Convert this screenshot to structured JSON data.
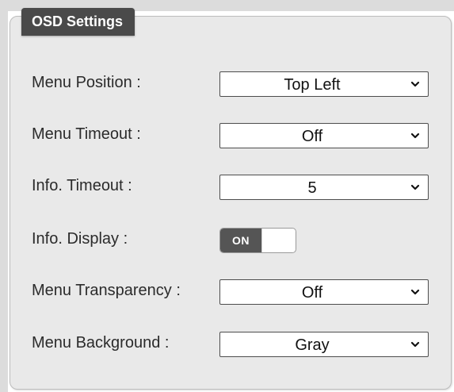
{
  "panel": {
    "title": "OSD Settings"
  },
  "settings": [
    {
      "label": "Menu Position :",
      "type": "select",
      "value": "Top Left"
    },
    {
      "label": "Menu Timeout :",
      "type": "select",
      "value": "Off"
    },
    {
      "label": "Info. Timeout :",
      "type": "select",
      "value": "5"
    },
    {
      "label": "Info. Display :",
      "type": "toggle",
      "value": "ON"
    },
    {
      "label": "Menu Transparency :",
      "type": "select",
      "value": "Off"
    },
    {
      "label": "Menu Background :",
      "type": "select",
      "value": "Gray"
    }
  ],
  "colors": {
    "tab_background": "#4a4a4a",
    "panel_background": "#e9e9e9",
    "toggle_on": "#555555"
  },
  "icons": {
    "select_arrow": "chevron-down-icon"
  }
}
